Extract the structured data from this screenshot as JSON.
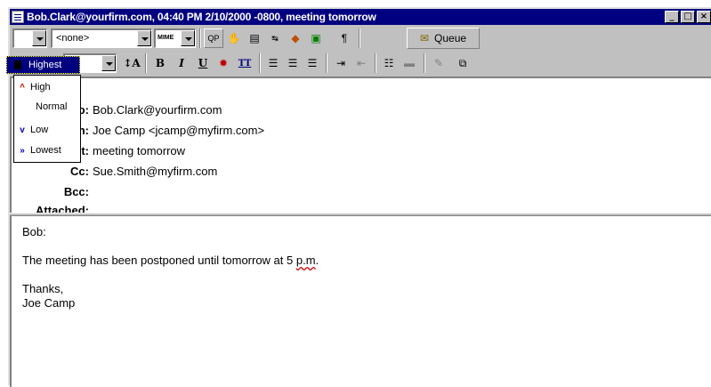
{
  "window": {
    "title": "Bob.Clark@yourfirm.com, 04:40 PM 2/10/2000 -0800, meeting tomorrow"
  },
  "toolbar1": {
    "style_combo_value": "<none>",
    "mime_label": "MIME",
    "queue_label": "Queue"
  },
  "toolbar2": {
    "priority_selected": "Highest"
  },
  "priority_menu": [
    {
      "label": "High",
      "icon": "arrow-up-icon",
      "color": "#d00000"
    },
    {
      "label": "Normal",
      "icon": "",
      "color": ""
    },
    {
      "label": "Low",
      "icon": "arrow-down-icon",
      "color": "#0000c0"
    },
    {
      "label": "Lowest",
      "icon": "double-arrow-down-icon",
      "color": "#0000c0"
    }
  ],
  "headers": {
    "to_value": "Bob.Clark@yourfirm.com",
    "from_value": "Joe Camp <jcamp@myfirm.com>",
    "subject_value": "meeting tomorrow",
    "cc_label": "Cc:",
    "cc_value": "Sue.Smith@myfirm.com",
    "bcc_label": "Bcc:",
    "bcc_value": "",
    "attached_label": "Attached:",
    "attached_value": ""
  },
  "body": {
    "greeting": "Bob:",
    "line1_before": "The meeting has been postponed until tomorrow at 5 ",
    "line1_misspelled": "p.m",
    "line1_after": ".",
    "signoff": "Thanks,",
    "signature": "Joe Camp"
  },
  "colors": {
    "titlebar": "#000080",
    "face": "#c0c0c0",
    "selection": "#000080"
  }
}
